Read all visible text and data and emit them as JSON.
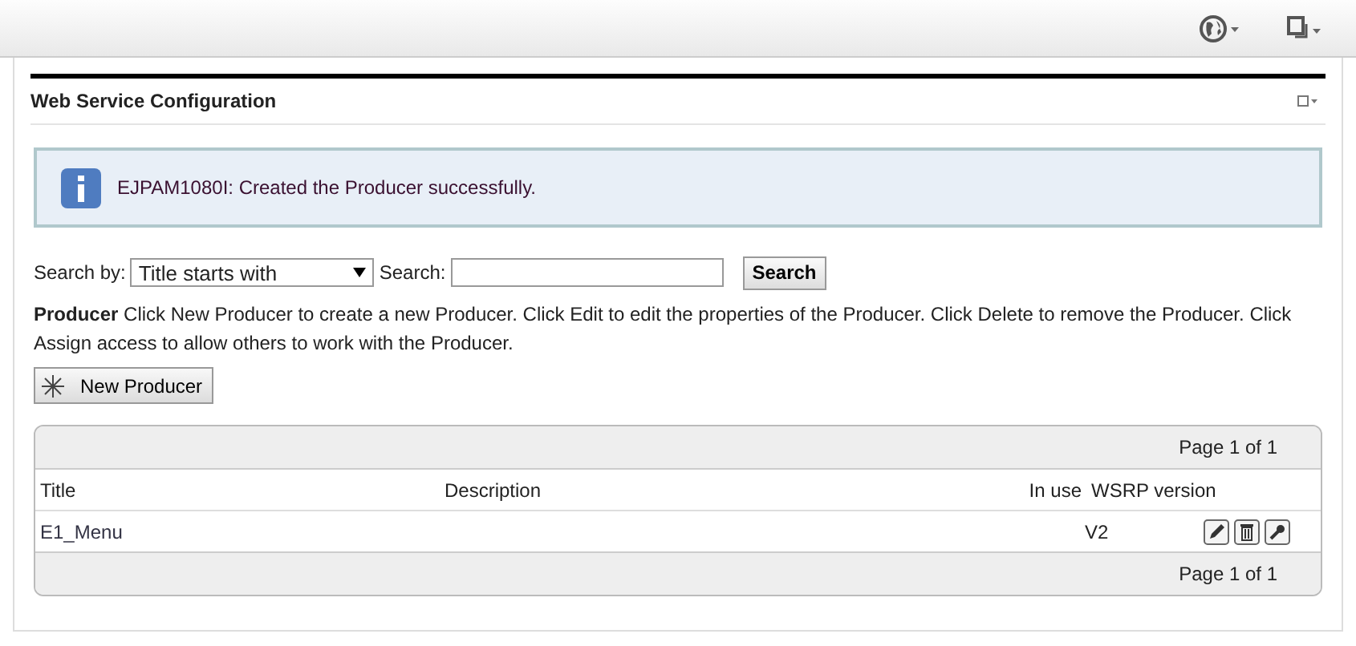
{
  "portlet": {
    "title": "Web Service Configuration"
  },
  "message": {
    "text": "EJPAM1080I: Created the Producer successfully."
  },
  "search": {
    "by_label": "Search by:",
    "by_value": "Title starts with",
    "field_label": "Search:",
    "button": "Search"
  },
  "description": "**Producer**  Click New Producer to create a new Producer. Click Edit to edit the properties of the Producer. Click Delete to remove the Producer. Click Assign access to allow others to work with the Producer.",
  "new_button": "New Producer",
  "table": {
    "pager_top": "Page 1 of 1",
    "pager_bottom": "Page 1 of 1",
    "columns": [
      "Title",
      "Description",
      "In use",
      "WSRP version"
    ],
    "rows": [
      {
        "title": "E1_Menu",
        "version": "V2"
      }
    ]
  }
}
